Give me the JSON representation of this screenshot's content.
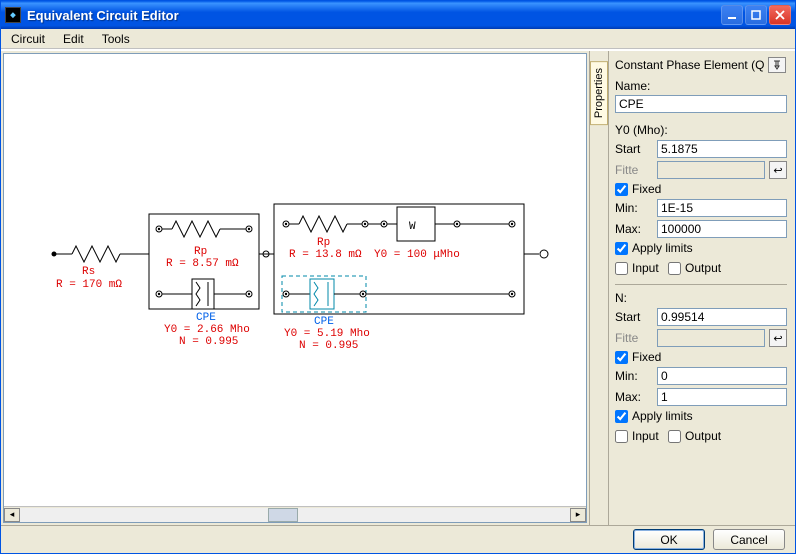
{
  "window": {
    "title": "Equivalent Circuit Editor"
  },
  "menubar": {
    "circuit": "Circuit",
    "edit": "Edit",
    "tools": "Tools"
  },
  "proptab": {
    "label": "Properties"
  },
  "panel": {
    "heading": "Constant Phase Element (Q",
    "name_label": "Name:",
    "name_value": "CPE",
    "y0": {
      "label": "Y0 (Mho):",
      "start_label": "Start",
      "start_value": "5.1875",
      "fitte_label": "Fitte",
      "fitte_value": "",
      "fixed_label": "Fixed",
      "fixed_checked": true,
      "min_label": "Min:",
      "min_value": "1E-15",
      "max_label": "Max:",
      "max_value": "100000",
      "apply_label": "Apply limits",
      "apply_checked": true,
      "input_label": "Input",
      "input_checked": false,
      "output_label": "Output",
      "output_checked": false
    },
    "n": {
      "label": "N:",
      "start_label": "Start",
      "start_value": "0.99514",
      "fitte_label": "Fitte",
      "fitte_value": "",
      "fixed_label": "Fixed",
      "fixed_checked": true,
      "min_label": "Min:",
      "min_value": "0",
      "max_label": "Max:",
      "max_value": "1",
      "apply_label": "Apply limits",
      "apply_checked": true,
      "input_label": "Input",
      "input_checked": false,
      "output_label": "Output",
      "output_checked": false
    }
  },
  "footer": {
    "ok": "OK",
    "cancel": "Cancel"
  },
  "circuit": {
    "rs": {
      "name": "Rs",
      "value": "R = 170 mΩ"
    },
    "rp1": {
      "name": "Rp",
      "value": "R = 8.57 mΩ"
    },
    "cpe1": {
      "name": "CPE",
      "y0": "Y0 = 2.66 Mho",
      "n": "N = 0.995"
    },
    "rp2": {
      "name": "Rp",
      "value": "R = 13.8 mΩ"
    },
    "warburg": {
      "name": "W",
      "value": "Y0 = 100 μMho"
    },
    "cpe2": {
      "name": "CPE",
      "y0": "Y0 = 5.19 Mho",
      "n": "N = 0.995"
    }
  }
}
